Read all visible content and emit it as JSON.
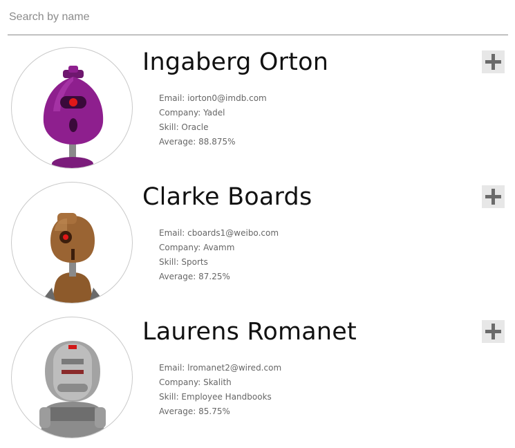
{
  "search": {
    "placeholder": "Search by name",
    "value": ""
  },
  "students": [
    {
      "name": "Ingaberg Orton",
      "email": "Email: iorton0@imdb.com",
      "company": "Company: Yadel",
      "skill": "Skill: Oracle",
      "average": "Average: 88.875%",
      "avatar_icon": "robot-avatar-purple-icon",
      "avatar_color": "#8e1f8e"
    },
    {
      "name": "Clarke Boards",
      "email": "Email: cboards1@weibo.com",
      "company": "Company: Avamm",
      "skill": "Skill: Sports",
      "average": "Average: 87.25%",
      "avatar_icon": "robot-avatar-brown-icon",
      "avatar_color": "#9a6433"
    },
    {
      "name": "Laurens Romanet",
      "email": "Email: lromanet2@wired.com",
      "company": "Company: Skalith",
      "skill": "Skill: Employee Handbooks",
      "average": "Average: 85.75%",
      "avatar_icon": "robot-avatar-gray-icon",
      "avatar_color": "#9a9a9a"
    }
  ],
  "expand_icon": "plus-icon",
  "colors": {
    "divider": "#8a8a8a",
    "button_bg": "#e7e7e7",
    "button_icon": "#6b6b6b",
    "detail_text": "#666666"
  }
}
